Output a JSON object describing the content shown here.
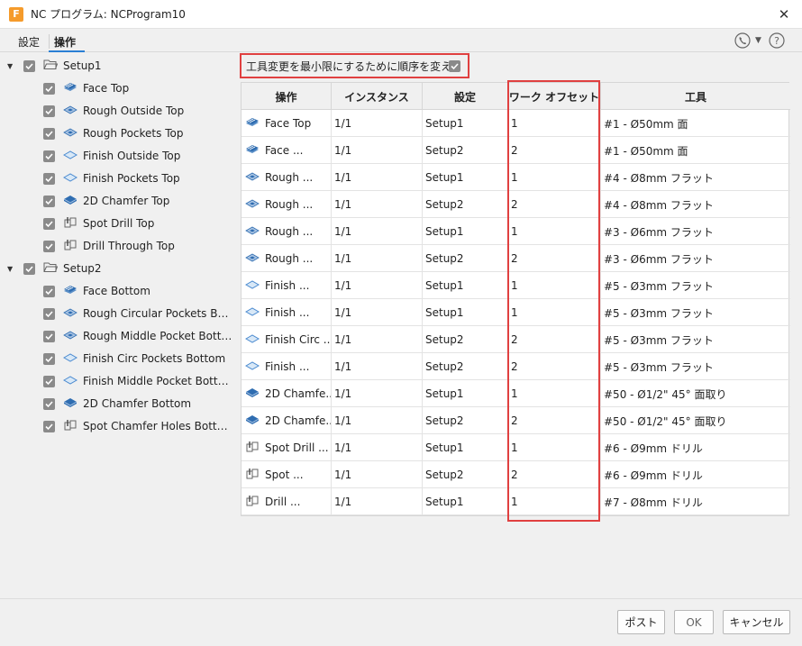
{
  "window": {
    "title": "NC プログラム: NCProgram10",
    "app_icon": "F",
    "close_glyph": "✕"
  },
  "tabs": [
    {
      "label": "設定"
    },
    {
      "label": "操作"
    }
  ],
  "tree": {
    "setups": [
      {
        "label": "Setup1",
        "checked": true,
        "items": [
          {
            "label": "Face Top",
            "icon": "face-icon"
          },
          {
            "label": "Rough Outside Top",
            "icon": "rough-icon"
          },
          {
            "label": "Rough Pockets Top",
            "icon": "rough-icon"
          },
          {
            "label": "Finish Outside Top",
            "icon": "finish-icon"
          },
          {
            "label": "Finish Pockets Top",
            "icon": "finish-icon"
          },
          {
            "label": "2D Chamfer Top",
            "icon": "chamfer-icon"
          },
          {
            "label": "Spot Drill Top",
            "icon": "drill-icon"
          },
          {
            "label": "Drill Through Top",
            "icon": "drill-icon"
          }
        ]
      },
      {
        "label": "Setup2",
        "checked": true,
        "items": [
          {
            "label": "Face Bottom",
            "icon": "face-icon"
          },
          {
            "label": "Rough Circular Pockets Botto...",
            "icon": "rough-icon"
          },
          {
            "label": "Rough Middle Pocket Bottom",
            "icon": "rough-icon"
          },
          {
            "label": "Finish Circ Pockets Bottom",
            "icon": "finish-icon"
          },
          {
            "label": "Finish Middle Pocket Bottom",
            "icon": "finish-icon"
          },
          {
            "label": "2D Chamfer Bottom",
            "icon": "chamfer-icon"
          },
          {
            "label": "Spot Chamfer Holes Bottom",
            "icon": "drill-icon"
          }
        ]
      }
    ]
  },
  "option": {
    "label": "工具変更を最小限にするために順序を変える",
    "checked": true
  },
  "table": {
    "headers": [
      "操作",
      "インスタンス",
      "設定",
      "ワーク オフセット",
      "工具"
    ],
    "rows": [
      {
        "icon": "face-icon",
        "op": "Face Top",
        "instance": "1/1",
        "setup": "Setup1",
        "offset": "1",
        "tool": "#1 - Ø50mm 面"
      },
      {
        "icon": "face-icon",
        "op": "Face ...",
        "instance": "1/1",
        "setup": "Setup2",
        "offset": "2",
        "tool": "#1 - Ø50mm 面"
      },
      {
        "icon": "rough-icon",
        "op": "Rough ...",
        "instance": "1/1",
        "setup": "Setup1",
        "offset": "1",
        "tool": "#4 - Ø8mm フラット"
      },
      {
        "icon": "rough-icon",
        "op": "Rough ...",
        "instance": "1/1",
        "setup": "Setup2",
        "offset": "2",
        "tool": "#4 - Ø8mm フラット"
      },
      {
        "icon": "rough-icon",
        "op": "Rough ...",
        "instance": "1/1",
        "setup": "Setup1",
        "offset": "1",
        "tool": "#3 - Ø6mm フラット"
      },
      {
        "icon": "rough-icon",
        "op": "Rough ...",
        "instance": "1/1",
        "setup": "Setup2",
        "offset": "2",
        "tool": "#3 - Ø6mm フラット"
      },
      {
        "icon": "finish-icon",
        "op": "Finish ...",
        "instance": "1/1",
        "setup": "Setup1",
        "offset": "1",
        "tool": "#5 - Ø3mm フラット"
      },
      {
        "icon": "finish-icon",
        "op": "Finish ...",
        "instance": "1/1",
        "setup": "Setup1",
        "offset": "1",
        "tool": "#5 - Ø3mm フラット"
      },
      {
        "icon": "finish-icon",
        "op": "Finish Circ ...",
        "instance": "1/1",
        "setup": "Setup2",
        "offset": "2",
        "tool": "#5 - Ø3mm フラット"
      },
      {
        "icon": "finish-icon",
        "op": "Finish ...",
        "instance": "1/1",
        "setup": "Setup2",
        "offset": "2",
        "tool": "#5 - Ø3mm フラット"
      },
      {
        "icon": "chamfer-icon",
        "op": "2D Chamfe...",
        "instance": "1/1",
        "setup": "Setup1",
        "offset": "1",
        "tool": "#50 - Ø1/2\" 45° 面取り"
      },
      {
        "icon": "chamfer-icon",
        "op": "2D Chamfe...",
        "instance": "1/1",
        "setup": "Setup2",
        "offset": "2",
        "tool": "#50 - Ø1/2\" 45° 面取り"
      },
      {
        "icon": "drill-icon",
        "op": "Spot Drill ...",
        "instance": "1/1",
        "setup": "Setup1",
        "offset": "1",
        "tool": "#6 - Ø9mm ドリル"
      },
      {
        "icon": "drill-icon",
        "op": "Spot ...",
        "instance": "1/1",
        "setup": "Setup2",
        "offset": "2",
        "tool": "#6 - Ø9mm ドリル"
      },
      {
        "icon": "drill-icon",
        "op": "Drill ...",
        "instance": "1/1",
        "setup": "Setup1",
        "offset": "1",
        "tool": "#7 - Ø8mm ドリル"
      }
    ]
  },
  "buttons": {
    "post": "ポスト",
    "ok": "OK",
    "cancel": "キャンセル"
  },
  "colors": {
    "highlight": "#e04040",
    "accent": "#2a7fd4"
  }
}
